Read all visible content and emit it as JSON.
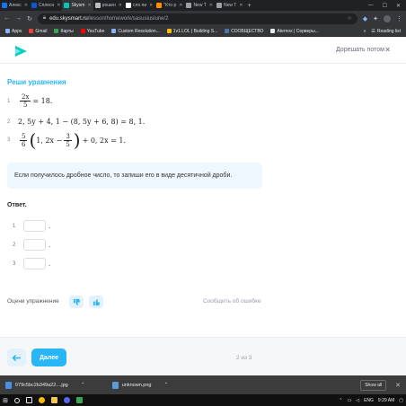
{
  "browser": {
    "tabs": [
      {
        "label": "Алекс",
        "color": "#1a73e8",
        "active": false
      },
      {
        "label": "Сплесн",
        "color": "#0b57d0",
        "active": false
      },
      {
        "label": "Skysm",
        "color": "#00c8b4",
        "active": true
      },
      {
        "label": "решен",
        "color": "#bdbdbd",
        "active": false
      },
      {
        "label": "сло пи",
        "color": "#ffffff",
        "active": false
      },
      {
        "label": "\"Кто р",
        "color": "#ff8f00",
        "active": false
      },
      {
        "label": "New T",
        "color": "#9aa0a6",
        "active": false
      },
      {
        "label": "New T",
        "color": "#9aa0a6",
        "active": false
      }
    ],
    "url_host": "edu.skysmart.ru",
    "url_path": "/lesson/homework/sasusiusiune/2",
    "bookmarks": [
      {
        "label": "Apps",
        "icon": "apps-grid-icon",
        "color": "#8ab4f8"
      },
      {
        "label": "Gmail",
        "icon": "gmail-icon",
        "color": "#ea4335"
      },
      {
        "label": "Карты",
        "icon": "maps-icon",
        "color": "#34a853"
      },
      {
        "label": "YouTube",
        "icon": "youtube-icon",
        "color": "#ff0000"
      },
      {
        "label": "Custom Resolution...",
        "icon": "globe-icon",
        "color": "#8ab4f8"
      },
      {
        "label": "1v1.LOL | Building S...",
        "icon": "game-icon",
        "color": "#fbbc04"
      },
      {
        "label": "СООБЩЕСТВО",
        "icon": "vk-icon",
        "color": "#4a76a8"
      },
      {
        "label": "Aternos | Серверы...",
        "icon": "aternos-icon",
        "color": "#e8eaed"
      }
    ],
    "reading_list": "Reading list"
  },
  "header": {
    "later_label": "Дорешать потом"
  },
  "task": {
    "title": "Реши уравнения",
    "equations": [
      {
        "num": "1",
        "frac_n": "2x",
        "frac_d": "5",
        "rest": "= 18."
      },
      {
        "num": "2",
        "text": "2, 5y + 4, 1 − (8, 5y + 6, 8) =  8, 1."
      },
      {
        "num": "3",
        "lead_n": "5",
        "lead_d": "6",
        "inner_a": "1, 2x − ",
        "inner_n": "3",
        "inner_d": "5",
        "rest": "+ 0, 2x = 1."
      }
    ],
    "hint": "Если получилось дробное число, то запиши его в виде десятичной дроби.",
    "answer_label": "Ответ.",
    "answers": [
      {
        "num": "1",
        "value": "",
        "suffix": "."
      },
      {
        "num": "2",
        "value": "",
        "suffix": "."
      },
      {
        "num": "3",
        "value": "",
        "suffix": "."
      }
    ],
    "rate_label": "Оцени упражнение",
    "report_label": "Сообщить об ошибке"
  },
  "footer": {
    "next_label": "Далее",
    "pager": "2 из 3"
  },
  "downloads": {
    "items": [
      {
        "name": "079c5bc2b349a22....jpg",
        "icon": "jpg-file-icon"
      },
      {
        "name": "unknown.png",
        "icon": "png-file-icon"
      }
    ],
    "show_all": "Show all"
  },
  "taskbar": {
    "lang": "ENG",
    "time": "9:29 AM"
  },
  "colors": {
    "accent": "#29b6f6",
    "brand": "#00d1c1",
    "hint_bg": "#eef7fd"
  }
}
